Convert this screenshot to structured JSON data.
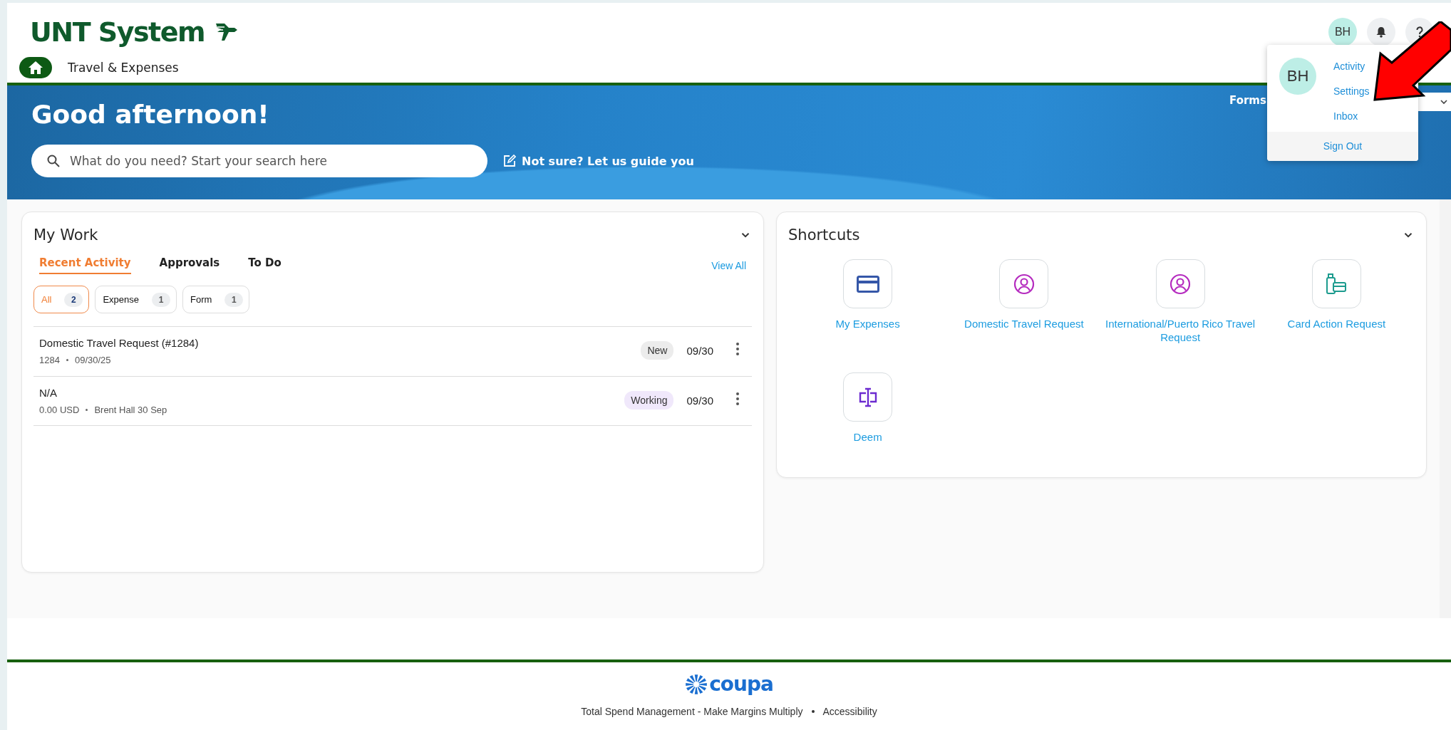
{
  "header": {
    "logo": "UNT System",
    "nav_title": "Travel & Expenses",
    "user_initials": "BH"
  },
  "hero": {
    "greeting": "Good afternoon!",
    "search": {
      "placeholder": "What do you need? Start your search here"
    },
    "guide_link": "Not sure? Let us guide you",
    "forms_label": "Forms"
  },
  "user_menu": {
    "initials": "BH",
    "items": [
      "Activity",
      "Settings",
      "Inbox"
    ],
    "sign_out": "Sign Out"
  },
  "my_work": {
    "title": "My Work",
    "view_all": "View All",
    "tabs": [
      {
        "label": "Recent Activity",
        "selected": true
      },
      {
        "label": "Approvals",
        "selected": false
      },
      {
        "label": "To Do",
        "selected": false
      }
    ],
    "filters": [
      {
        "label": "All",
        "count": "2",
        "selected": true
      },
      {
        "label": "Expense",
        "count": "1",
        "selected": false
      },
      {
        "label": "Form",
        "count": "1",
        "selected": false
      }
    ],
    "rows": [
      {
        "title": "Domestic Travel Request (#1284)",
        "meta": [
          "1284",
          "09/30/25"
        ],
        "status": "New",
        "color": "#ececec",
        "date": "09/30"
      },
      {
        "title": "N/A",
        "meta": [
          "0.00 USD",
          "Brent Hall 30 Sep"
        ],
        "status": "Working",
        "color": "#f0e8fb",
        "date": "09/30"
      }
    ]
  },
  "shortcuts": {
    "title": "Shortcuts",
    "items": [
      {
        "label": "My Expenses",
        "kind": "card"
      },
      {
        "label": "Domestic Travel Request",
        "kind": "person"
      },
      {
        "label": "International/Puerto Rico Travel Request",
        "kind": "person"
      },
      {
        "label": "Card Action Request",
        "kind": "luggage"
      },
      {
        "label": "Deem",
        "kind": "deem"
      }
    ]
  },
  "footer": {
    "logo": "coupa",
    "links": [
      "Total Spend Management - Make Margins Multiply",
      "Accessibility"
    ]
  }
}
